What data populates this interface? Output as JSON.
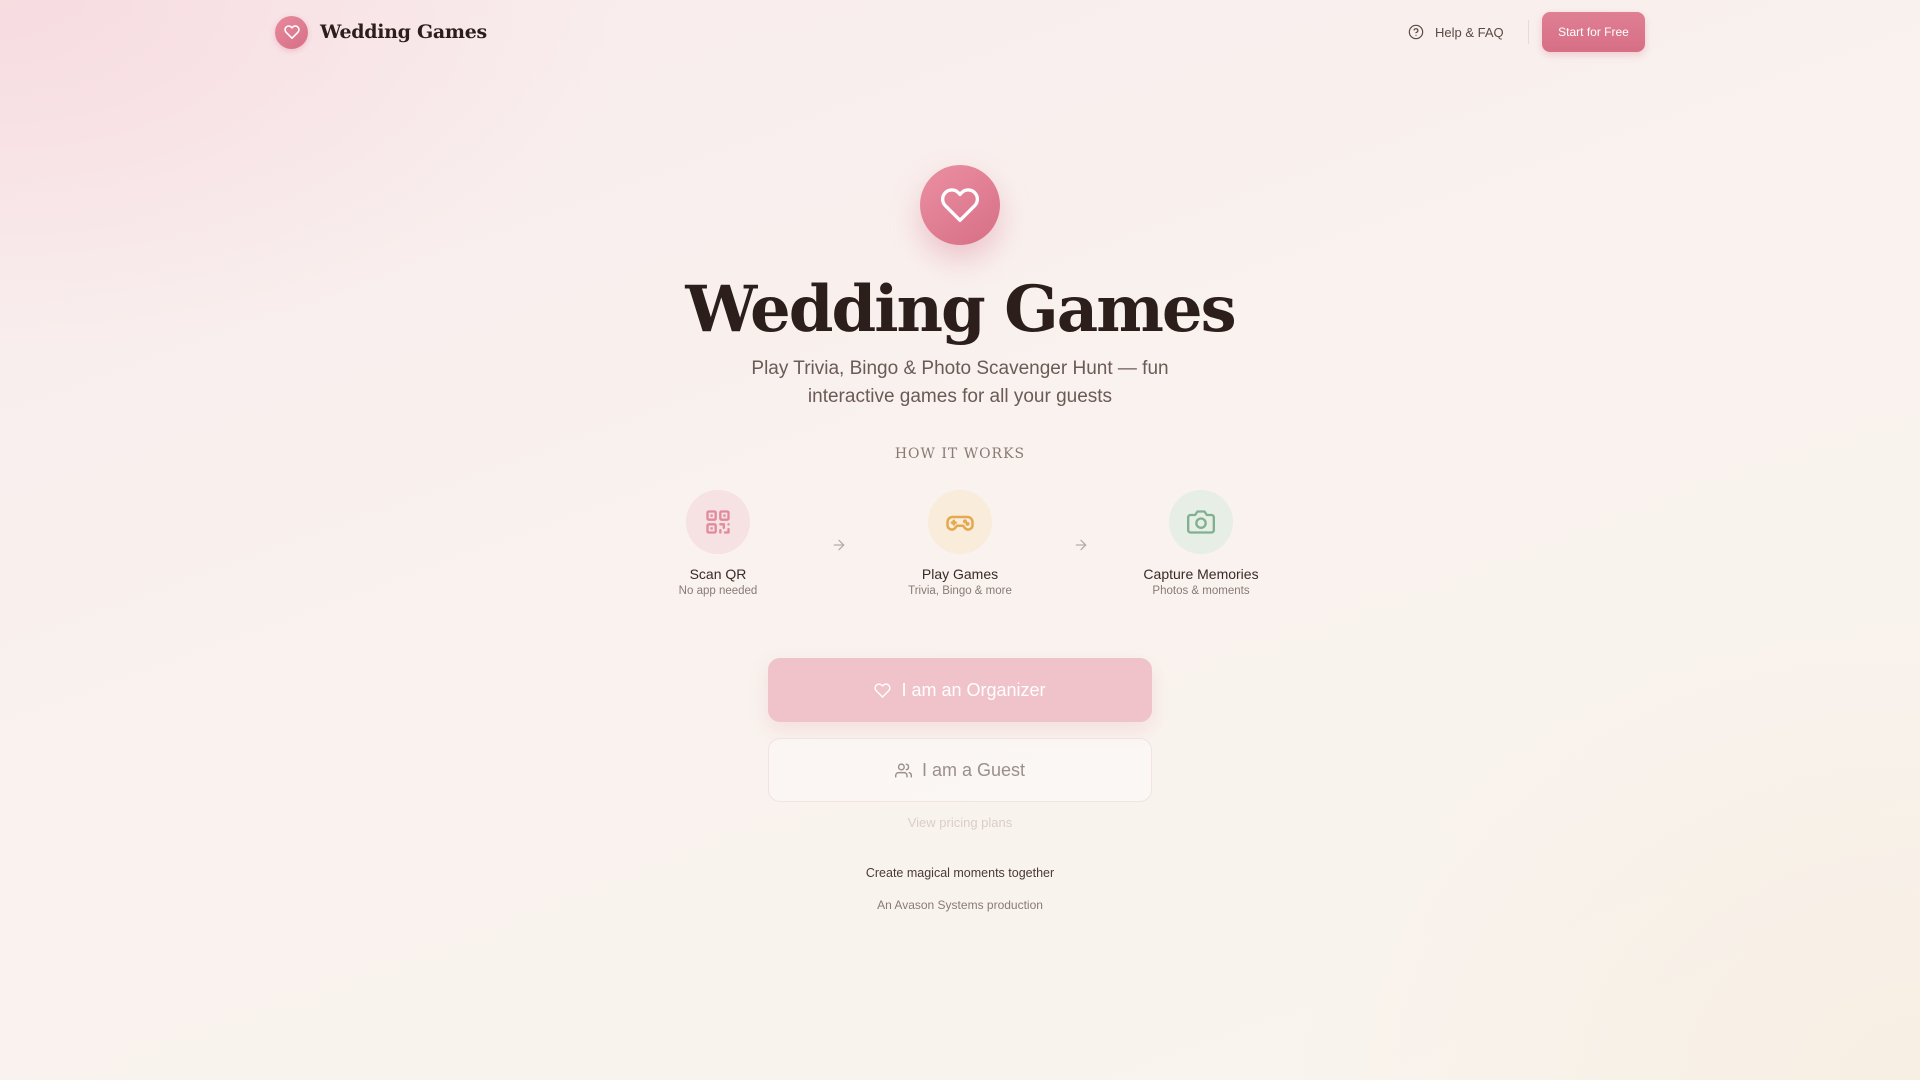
{
  "header": {
    "brand_name": "Wedding Games",
    "help_label": "Help & FAQ",
    "cta_label": "Start for Free"
  },
  "hero": {
    "title": "Wedding Games",
    "subtitle": "Play Trivia, Bingo & Photo Scavenger Hunt — fun interactive games for all your guests",
    "icon": "heart-icon"
  },
  "how_it_works": {
    "title": "HOW IT WORKS",
    "steps": [
      {
        "label": "Scan QR",
        "sub": "No app needed",
        "icon": "qr-code-icon",
        "color": "#e08a9b",
        "bg": "#f6e1e3"
      },
      {
        "label": "Play Games",
        "sub": "Trivia, Bingo & more",
        "icon": "gamepad-icon",
        "color": "#e4a84e",
        "bg": "#f9ecdb"
      },
      {
        "label": "Capture Memories",
        "sub": "Photos & moments",
        "icon": "camera-icon",
        "color": "#7fb08f",
        "bg": "#e7eee6"
      }
    ]
  },
  "actions": {
    "organizer_label": "I am an Organizer",
    "guest_label": "I am a Guest",
    "pricing_label": "View pricing plans"
  },
  "footer": {
    "tagline": "Create magical moments together",
    "credit": "An Avason Systems production"
  },
  "colors": {
    "accent": "#d66f86",
    "text_dark": "#2c1f1b",
    "text_muted": "#8a7a74"
  }
}
